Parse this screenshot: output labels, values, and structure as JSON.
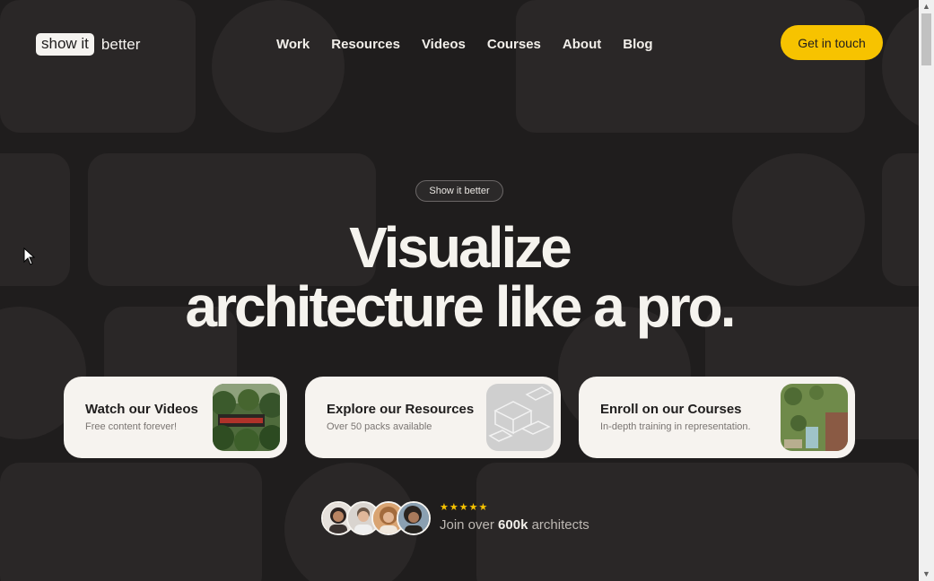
{
  "header": {
    "logo_box": "show it",
    "logo_text": "better",
    "nav": [
      "Work",
      "Resources",
      "Videos",
      "Courses",
      "About",
      "Blog"
    ],
    "cta": "Get in touch"
  },
  "hero": {
    "badge": "Show it better",
    "title_line1": "Visualize",
    "title_line2": "architecture like a pro."
  },
  "cards": [
    {
      "title": "Watch our Videos",
      "subtitle": "Free content forever!",
      "image": "jungle-house-image"
    },
    {
      "title": "Explore our Resources",
      "subtitle": "Over 50 packs available",
      "image": "isometric-drawing-image"
    },
    {
      "title": "Enroll on our Courses",
      "subtitle": "In-depth training in representation.",
      "image": "site-plan-image"
    }
  ],
  "social_proof": {
    "stars": 5,
    "star_glyph": "★",
    "join_prefix": "Join over",
    "join_count": "600k",
    "join_suffix": "architects"
  },
  "colors": {
    "background": "#1f1d1d",
    "accent": "#f7c300",
    "card": "#f6f3ef",
    "text_light": "#f5f3ee"
  }
}
